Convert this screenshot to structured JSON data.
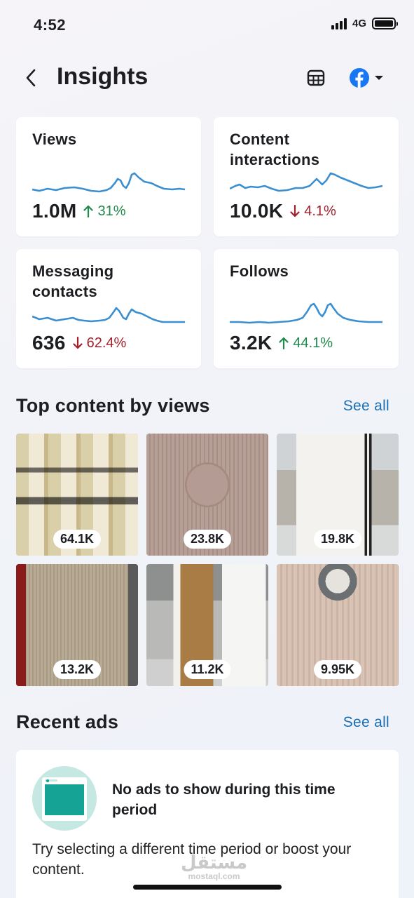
{
  "status_bar": {
    "time": "4:52",
    "network": "4G"
  },
  "header": {
    "title": "Insights"
  },
  "metrics": [
    {
      "title": "Views",
      "value": "1.0M",
      "change": "31%",
      "direction": "up"
    },
    {
      "title": "Content interactions",
      "value": "10.0K",
      "change": "4.1%",
      "direction": "down"
    },
    {
      "title": "Messaging contacts",
      "value": "636",
      "change": "62.4%",
      "direction": "down"
    },
    {
      "title": "Follows",
      "value": "3.2K",
      "change": "44.1%",
      "direction": "up"
    }
  ],
  "top_content": {
    "title": "Top content by views",
    "see_all": "See all",
    "items": [
      {
        "views": "64.1K"
      },
      {
        "views": "23.8K"
      },
      {
        "views": "19.8K"
      },
      {
        "views": "13.2K"
      },
      {
        "views": "11.2K"
      },
      {
        "views": "9.95K"
      }
    ]
  },
  "recent_ads": {
    "title": "Recent ads",
    "see_all": "See all",
    "empty_title": "No ads to show during this time period",
    "empty_desc": "Try selecting a different time period or boost your content."
  },
  "watermark": {
    "arabic": "مستقل",
    "latin": "mostaql.com"
  },
  "colors": {
    "sparkline": "#3b8fd0",
    "up": "#1f8a4c",
    "down": "#a3202b",
    "link": "#1b6fb5",
    "facebook": "#1877f2"
  },
  "icons": [
    "signal-icon",
    "battery-icon",
    "back-icon",
    "export-table-icon",
    "facebook-icon",
    "chevron-down-icon",
    "arrow-up-icon",
    "arrow-down-icon"
  ]
}
